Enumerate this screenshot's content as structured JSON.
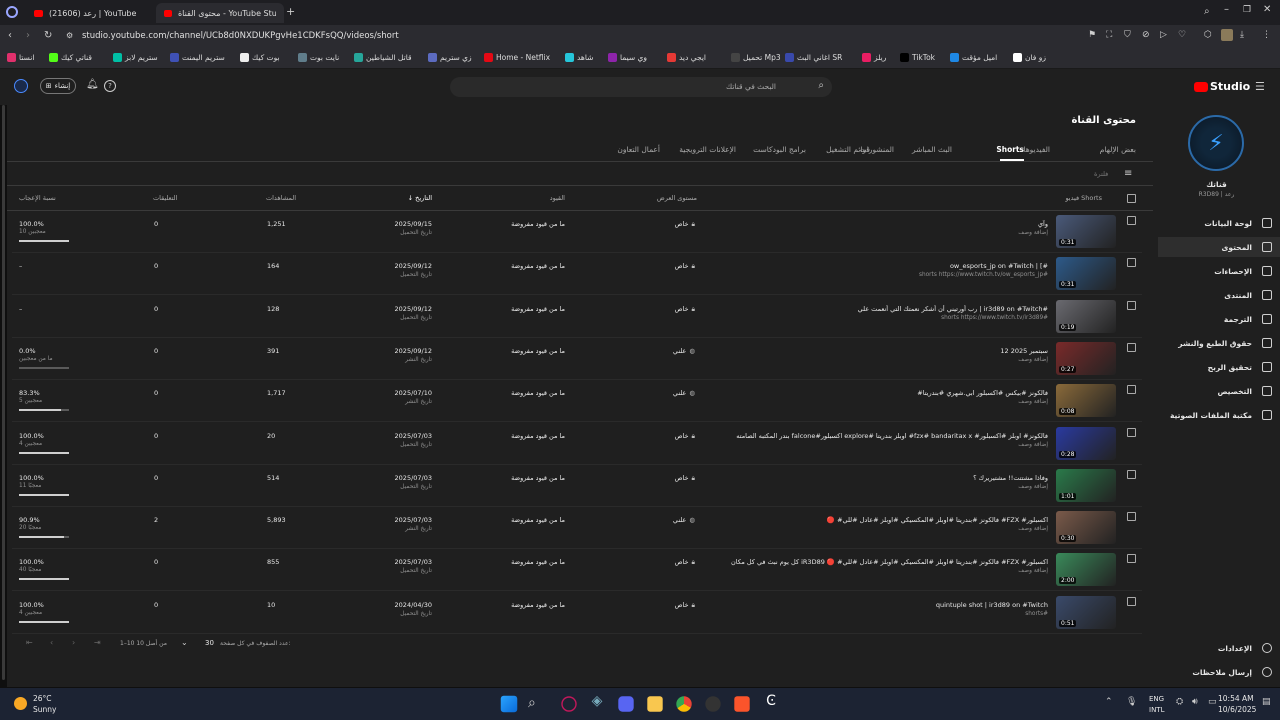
{
  "browser": {
    "tabs": [
      {
        "label": "(21606) رعد | YouTube",
        "active": false
      },
      {
        "label": "محتوى القناة - YouTube Studio",
        "active": true
      }
    ],
    "new_tab": "+",
    "url": "studio.youtube.com/channel/UCb8d0NXDUKPgvHe1CDKFsQQ/videos/short",
    "bookmarks": [
      {
        "label": "زو فان",
        "color": "#ffffff"
      },
      {
        "label": "اميل مؤقت",
        "color": "#1e88e5"
      },
      {
        "label": "TikTok",
        "color": "#000000"
      },
      {
        "label": "ريلز",
        "color": "#e91e63"
      },
      {
        "label": "اغاني البث SR",
        "color": "#3949ab"
      },
      {
        "label": "تحميل Mp3",
        "color": "#444444"
      },
      {
        "label": "ايجي ديد",
        "color": "#e53935"
      },
      {
        "label": "وي سيما",
        "color": "#8e24aa"
      },
      {
        "label": "شاهد",
        "color": "#26c6da"
      },
      {
        "label": "Home - Netflix",
        "color": "#e50914"
      },
      {
        "label": "زي ستريم",
        "color": "#5c6bc0"
      },
      {
        "label": "قاتل الشياطين",
        "color": "#26a69a"
      },
      {
        "label": "نايت بوت",
        "color": "#607d8b"
      },
      {
        "label": "بوت كيك",
        "color": "#eeeeee"
      },
      {
        "label": "ستريم اليمنت",
        "color": "#3f51b5"
      },
      {
        "label": "ستريم لابز",
        "color": "#00bfa5"
      },
      {
        "label": "قناتي كيك",
        "color": "#53fc18"
      },
      {
        "label": "انستا",
        "color": "#e1306c"
      }
    ]
  },
  "studio": {
    "logo": "Studio",
    "search_placeholder": "البحث في قناتك",
    "create_label": "إنشاء",
    "channel_name": "قناتك",
    "channel_handle": "R3D89 | رعد",
    "page_title": "محتوى القناة",
    "nav": [
      {
        "label": "لوحة البيانات",
        "icon": "dashboard-icon",
        "active": false
      },
      {
        "label": "المحتوى",
        "icon": "content-icon",
        "active": true
      },
      {
        "label": "الإحصاءات",
        "icon": "analytics-icon",
        "active": false
      },
      {
        "label": "المنتدى",
        "icon": "community-icon",
        "active": false
      },
      {
        "label": "الترجمة",
        "icon": "subtitles-icon",
        "active": false
      },
      {
        "label": "حقوق الطبع والنشر",
        "icon": "copyright-icon",
        "active": false
      },
      {
        "label": "تحقيق الربح",
        "icon": "dollar-icon",
        "active": false
      },
      {
        "label": "التخصيص",
        "icon": "magic-wand-icon",
        "active": false
      },
      {
        "label": "مكتبة الملفات الصوتية",
        "icon": "audio-library-icon",
        "active": false
      }
    ],
    "nav_bottom": [
      {
        "label": "الإعدادات",
        "icon": "gear-icon"
      },
      {
        "label": "إرسال ملاحظات",
        "icon": "feedback-icon"
      }
    ],
    "tabs": [
      {
        "label": "بعض الإلهام",
        "active": false
      },
      {
        "label": "الفيديوهات",
        "active": false
      },
      {
        "label": "Shorts",
        "active": true
      },
      {
        "label": "البث المباشر",
        "active": false
      },
      {
        "label": "المنشورات",
        "active": false
      },
      {
        "label": "قوائم التشغيل",
        "active": false
      },
      {
        "label": "برامج البودكاست",
        "active": false
      },
      {
        "label": "الإعلانات الترويجية",
        "active": false
      },
      {
        "label": "أعمال التعاون",
        "active": false
      }
    ],
    "filter_label": "فلترة",
    "columns": {
      "video": "فيديو Shorts",
      "visibility": "مستوى العرض",
      "restrictions": "القيود",
      "date": "التاريخ",
      "views": "المشاهدات",
      "comments": "التعليقات",
      "likes": "نسبة الإعجاب"
    },
    "rows": [
      {
        "title": "وآي",
        "desc": "إضافة وصف",
        "duration": "0:31",
        "visibility": "خاص",
        "vis_icon": "lock-icon",
        "restriction": "ما من قيود مفروضة",
        "date": "2025/09/15",
        "date_type": "تاريخ التحميل",
        "views": "1,251",
        "comments": "0",
        "likes_pct": "100.0%",
        "likes_count": "10 معجبين",
        "like_ratio": 1.0,
        "thumb": "#4a5a7a"
      },
      {
        "title": "ow_esports_jp on #Twitch | [#",
        "desc": "shorts https://www.twitch.tv/ow_esports_jp#",
        "duration": "0:31",
        "visibility": "خاص",
        "vis_icon": "lock-icon",
        "restriction": "ما من قيود مفروضة",
        "date": "2025/09/12",
        "date_type": "تاريخ التحميل",
        "views": "164",
        "comments": "0",
        "likes_pct": "–",
        "likes_count": "",
        "like_ratio": null,
        "thumb": "#2d5a8a"
      },
      {
        "title": "رب أورتيني أن أشكر نعمتك التي أنعمت علي | ir3d89 on #Twitch#",
        "desc": "shorts https://www.twitch.tv/ir3d89#",
        "duration": "0:19",
        "visibility": "خاص",
        "vis_icon": "lock-icon",
        "restriction": "ما من قيود مفروضة",
        "date": "2025/09/12",
        "date_type": "تاريخ التحميل",
        "views": "128",
        "comments": "0",
        "likes_pct": "–",
        "likes_count": "",
        "like_ratio": null,
        "thumb": "#6a6a70"
      },
      {
        "title": "12 سبتمبر 2025",
        "desc": "إضافة وصف",
        "duration": "0:27",
        "visibility": "علني",
        "vis_icon": "globe-icon",
        "restriction": "ما من قيود مفروضة",
        "date": "2025/09/12",
        "date_type": "تاريخ النشر",
        "views": "391",
        "comments": "0",
        "likes_pct": "0.0%",
        "likes_count": "ما من معجبين",
        "like_ratio": 0.0,
        "thumb": "#7a2a2a"
      },
      {
        "title": "#فالكونز #بيكس #اكسبلور ابي.شهري #بندريتا",
        "desc": "إضافة وصف",
        "duration": "0:08",
        "visibility": "علني",
        "vis_icon": "globe-icon",
        "restriction": "ما من قيود مفروضة",
        "date": "2025/07/10",
        "date_type": "تاريخ النشر",
        "views": "1,717",
        "comments": "0",
        "likes_pct": "83.3%",
        "likes_count": "5 معجبين",
        "like_ratio": 0.833,
        "thumb": "#8a6a3a"
      },
      {
        "title": "بندر المكتبه الصامته falcone#اكسبلور explore# اوبلز بندريتا #fzx# bandaritax x #فالكونز# اوبلز #اكسبلور",
        "desc": "إضافة وصف",
        "duration": "0:28",
        "visibility": "خاص",
        "vis_icon": "lock-icon",
        "restriction": "ما من قيود مفروضة",
        "date": "2025/07/03",
        "date_type": "تاريخ التحميل",
        "views": "20",
        "comments": "0",
        "likes_pct": "100.0%",
        "likes_count": "4 معجبين",
        "like_ratio": 1.0,
        "thumb": "#2a3aa0"
      },
      {
        "title": "وفاذا مشتتت!! مشتيريرك ؟",
        "desc": "إضافة وصف",
        "duration": "1:01",
        "visibility": "خاص",
        "vis_icon": "lock-icon",
        "restriction": "ما من قيود مفروضة",
        "date": "2025/07/03",
        "date_type": "تاريخ التحميل",
        "views": "514",
        "comments": "0",
        "likes_pct": "100.0%",
        "likes_count": "11 معجبًا",
        "like_ratio": 1.0,
        "thumb": "#2a7a4a"
      },
      {
        "title": "🔴 #فالكونز #بندريتا #اوبلز #المكسيكي #اوبلز #عادل #للي #FZX #اكسبلور",
        "desc": "إضافة وصف",
        "duration": "0:30",
        "visibility": "علني",
        "vis_icon": "globe-icon",
        "restriction": "ما من قيود مفروضة",
        "date": "2025/07/03",
        "date_type": "تاريخ النشر",
        "views": "5,893",
        "comments": "2",
        "likes_pct": "90.9%",
        "likes_count": "20 معجبًا",
        "like_ratio": 0.909,
        "thumb": "#7a5a4a"
      },
      {
        "title": "كل يوم نبث في كل مكان iR3D89 🔴 #فالكونز #بندريتا #اوبلز #المكسيكي #اوبلز #عادل #للي #FZX #اكسبلور",
        "desc": "إضافة وصف",
        "duration": "2:00",
        "visibility": "خاص",
        "vis_icon": "lock-icon",
        "restriction": "ما من قيود مفروضة",
        "date": "2025/07/03",
        "date_type": "تاريخ التحميل",
        "views": "855",
        "comments": "0",
        "likes_pct": "100.0%",
        "likes_count": "40 معجبًا",
        "like_ratio": 1.0,
        "thumb": "#3a8a5a"
      },
      {
        "title": "quintuple shot | ir3d89 on #Twitch",
        "desc": "shorts#",
        "duration": "0:51",
        "visibility": "خاص",
        "vis_icon": "lock-icon",
        "restriction": "ما من قيود مفروضة",
        "date": "2024/04/30",
        "date_type": "تاريخ التحميل",
        "views": "10",
        "comments": "0",
        "likes_pct": "100.0%",
        "likes_count": "4 معجبين",
        "like_ratio": 1.0,
        "thumb": "#3a4a6a"
      }
    ],
    "pagination": {
      "rows_per_page_label": "عدد الصفوف في كل صفحة:",
      "rows_per_page": "30",
      "range": "1–10 من أصل 10"
    }
  },
  "taskbar": {
    "weather_temp": "26°C",
    "weather_desc": "Sunny",
    "lang_top": "ENG",
    "lang_bottom": "INTL",
    "time": "10:54 AM",
    "date": "10/6/2025"
  },
  "colors": {
    "accent_red": "#ff0000",
    "bg": "#1f1f1f"
  }
}
